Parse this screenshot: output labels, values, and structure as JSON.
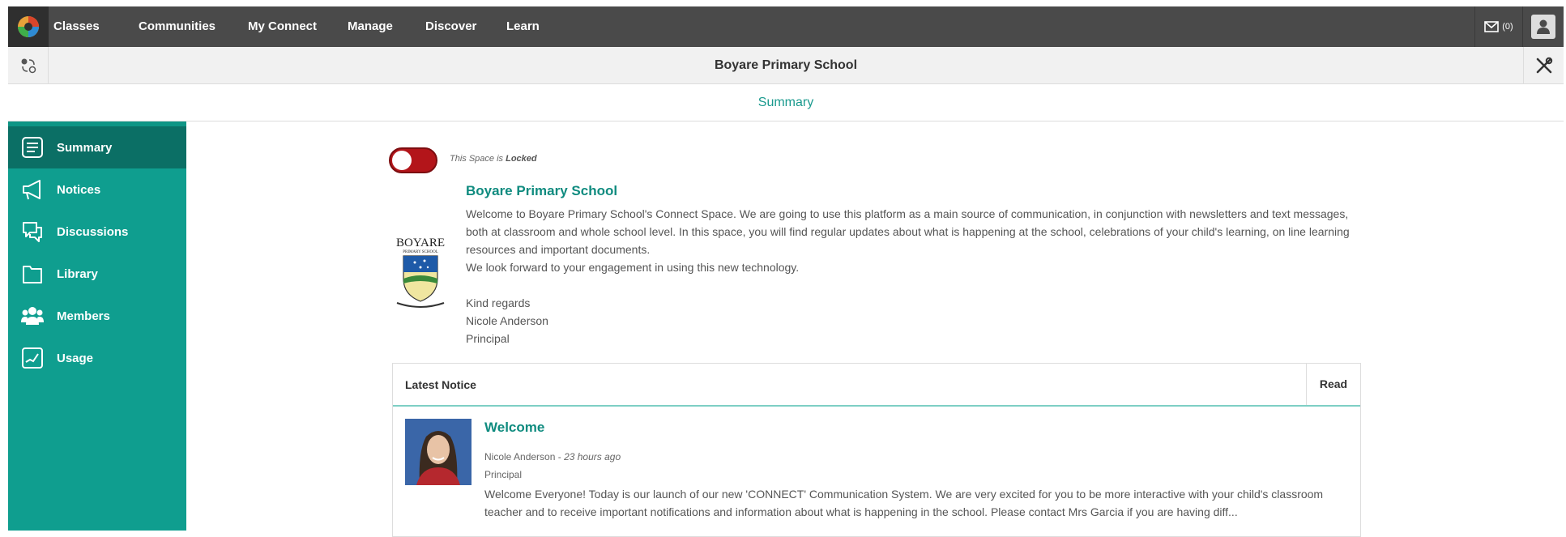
{
  "nav": {
    "items": [
      "Classes",
      "Communities",
      "My Connect",
      "Manage",
      "Discover",
      "Learn"
    ],
    "mail_count": "(0)"
  },
  "space": {
    "title": "Boyare Primary School",
    "page": "Summary"
  },
  "sidebar": {
    "items": [
      {
        "label": "Summary",
        "icon": "summary-icon"
      },
      {
        "label": "Notices",
        "icon": "megaphone-icon"
      },
      {
        "label": "Discussions",
        "icon": "discussion-icon"
      },
      {
        "label": "Library",
        "icon": "folder-icon"
      },
      {
        "label": "Members",
        "icon": "members-icon"
      },
      {
        "label": "Usage",
        "icon": "chart-icon"
      }
    ]
  },
  "lock": {
    "prefix": "This Space is",
    "state": "Locked"
  },
  "summary": {
    "school_name": "Boyare Primary School",
    "logo_text": "BOYARE",
    "logo_subtext": "PRIMARY SCHOOL",
    "paragraphs": [
      "Welcome to Boyare Primary School's Connect Space. We are going to use this platform as a main source of communication, in conjunction with newsletters and text messages, both at classroom and whole school level. In this space, you will find regular updates about what is happening at the school, celebrations of your child's learning, on line learning resources and important documents.",
      "We look forward to your engagement in using this new technology.",
      "",
      "Kind regards",
      "Nicole Anderson",
      "Principal"
    ]
  },
  "notice": {
    "header": "Latest Notice",
    "read_label": "Read",
    "title": "Welcome",
    "author": "Nicole Anderson",
    "separator": "-",
    "time": "23 hours ago",
    "role": "Principal",
    "body": "Welcome Everyone! Today is our launch of our new 'CONNECT' Communication System. We are very excited for you to be more interactive with your child's classroom teacher and to receive important notifications and information about what is happening in the school. Please contact Mrs Garcia if you are having diff..."
  },
  "colors": {
    "nav_bg": "#4a4a4a",
    "accent": "#0f9e8f",
    "accent_dark": "#0b6f65",
    "lock_red": "#b3151a"
  }
}
